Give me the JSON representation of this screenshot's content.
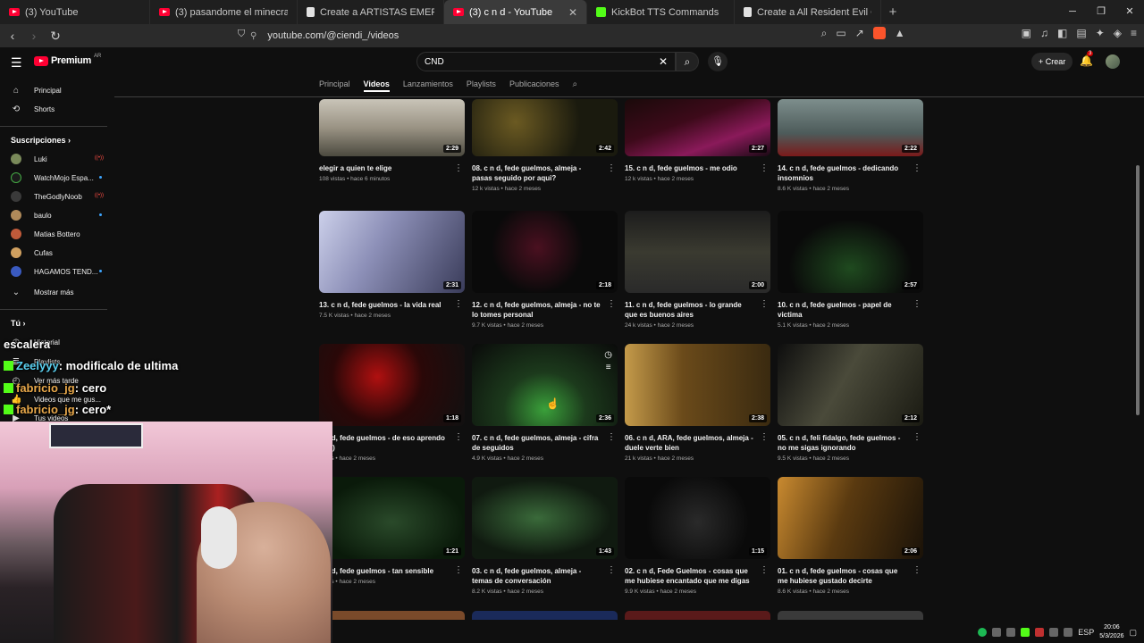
{
  "browser": {
    "tabs": [
      {
        "title": "(3) YouTube",
        "icon": "youtube-icon",
        "active": false
      },
      {
        "title": "(3) pasandome el minecraft en todas",
        "icon": "youtube-icon",
        "active": false
      },
      {
        "title": "Create a ARTISTAS EMERGENTES Tier",
        "icon": "doc-icon",
        "active": false
      },
      {
        "title": "(3) c n d - YouTube",
        "icon": "youtube-icon",
        "active": true
      },
      {
        "title": "KickBot TTS Commands",
        "icon": "kick-icon",
        "active": false
      },
      {
        "title": "Create a All Resident Evil Games (202",
        "icon": "doc-icon",
        "active": false
      }
    ],
    "url": "youtube.com/@ciendi_/videos"
  },
  "youtube": {
    "logo_text": "Premium",
    "country": "AR",
    "search_value": "CND",
    "create_label": "Crear",
    "notif_count": "3"
  },
  "sidebar": {
    "nav": [
      {
        "label": "Principal",
        "icon": "home-icon"
      },
      {
        "label": "Shorts",
        "icon": "shorts-icon"
      }
    ],
    "subs_heading": "Suscripciones",
    "subs": [
      {
        "label": "Luki",
        "color": "#7a8a5a",
        "status": "live"
      },
      {
        "label": "WatchMojo Espa...",
        "color": "#1a1a1a",
        "status": "dot"
      },
      {
        "label": "TheGodlyNoob",
        "color": "#3a3a3a",
        "status": "live"
      },
      {
        "label": "baulo",
        "color": "#b08a5a",
        "status": "dot"
      },
      {
        "label": "Matias Bottero",
        "color": "#c05a3a",
        "status": ""
      },
      {
        "label": "Cufas",
        "color": "#d0a060",
        "status": ""
      },
      {
        "label": "HAGAMOS TEND...",
        "color": "#3a5ac0",
        "status": "dot"
      }
    ],
    "show_more": "Mostrar más",
    "you_heading": "Tú",
    "you_items": [
      "Historial",
      "Playlists",
      "Ver más tarde",
      "Videos que me gus...",
      "Tus videos"
    ]
  },
  "channel_tabs": [
    "Principal",
    "Videos",
    "Lanzamientos",
    "Playlists",
    "Publicaciones"
  ],
  "active_tab": "Videos",
  "videos": [
    {
      "title": "elegir a quien te elige",
      "meta": "108 vistas • hace 6 minutos",
      "duration": "2:29"
    },
    {
      "title": "08. c n d, fede guelmos, almeja - pasas seguido por aqui?",
      "meta": "12 k vistas • hace 2 meses",
      "duration": "2:42"
    },
    {
      "title": "15. c n d, fede guelmos - me odio",
      "meta": "12 k vistas • hace 2 meses",
      "duration": "2:27"
    },
    {
      "title": "14. c n d, fede guelmos - dedicando insomnios",
      "meta": "8.6 K vistas • hace 2 meses",
      "duration": "2:22"
    },
    {
      "title": "13. c n d, fede guelmos - la vida real",
      "meta": "7.5 K vistas • hace 2 meses",
      "duration": "2:31"
    },
    {
      "title": "12. c n d, fede guelmos, almeja - no te lo tomes personal",
      "meta": "9.7 K vistas • hace 2 meses",
      "duration": "2:18"
    },
    {
      "title": "11. c n d, fede guelmos - lo grande que es buenos aires",
      "meta": "24 k vistas • hace 2 meses",
      "duration": "2:00"
    },
    {
      "title": "10. c n d, fede guelmos - papel de victima",
      "meta": "5.1 K vistas • hace 2 meses",
      "duration": "2:57"
    },
    {
      "title": "c n d, fede guelmos - de eso aprendo piro)",
      "meta": "vistas • hace 2 meses",
      "duration": "1:18"
    },
    {
      "title": "07. c n d, fede guelmos, almeja - cifra de seguidos",
      "meta": "4.9 K vistas • hace 2 meses",
      "duration": "2:36"
    },
    {
      "title": "06. c n d, ARA, fede guelmos, almeja - duele verte bien",
      "meta": "21 k vistas • hace 2 meses",
      "duration": "2:38"
    },
    {
      "title": "05. c n d, feli fidalgo, fede guelmos - no me sigas ignorando",
      "meta": "9.5 K vistas • hace 2 meses",
      "duration": "2:12"
    },
    {
      "title": "c n d, fede guelmos - tan sensible",
      "meta": "vistas • hace 2 meses",
      "duration": "1:21"
    },
    {
      "title": "03. c n d, fede guelmos, almeja - temas de conversación",
      "meta": "8.2 K vistas • hace 2 meses",
      "duration": "1:43"
    },
    {
      "title": "02. c n d, Fede Guelmos - cosas que me hubiese encantado que me digas",
      "meta": "9.9 K vistas • hace 2 meses",
      "duration": "1:15"
    },
    {
      "title": "01. c n d, fede guelmos - cosas que me hubiese gustado decirte",
      "meta": "8.6 K vistas • hace 2 meses",
      "duration": "2:06"
    }
  ],
  "chat": [
    {
      "user": "",
      "text": "escalera"
    },
    {
      "user": "Zeelyyy",
      "text": ": modificalo de ultima"
    },
    {
      "user": "fabricio_jg",
      "text": ": cero"
    },
    {
      "user": "fabricio_jg",
      "text": ": cero*"
    }
  ],
  "taskbar": {
    "lang": "ESP",
    "time": "20:06",
    "date": "5/3/2026"
  }
}
